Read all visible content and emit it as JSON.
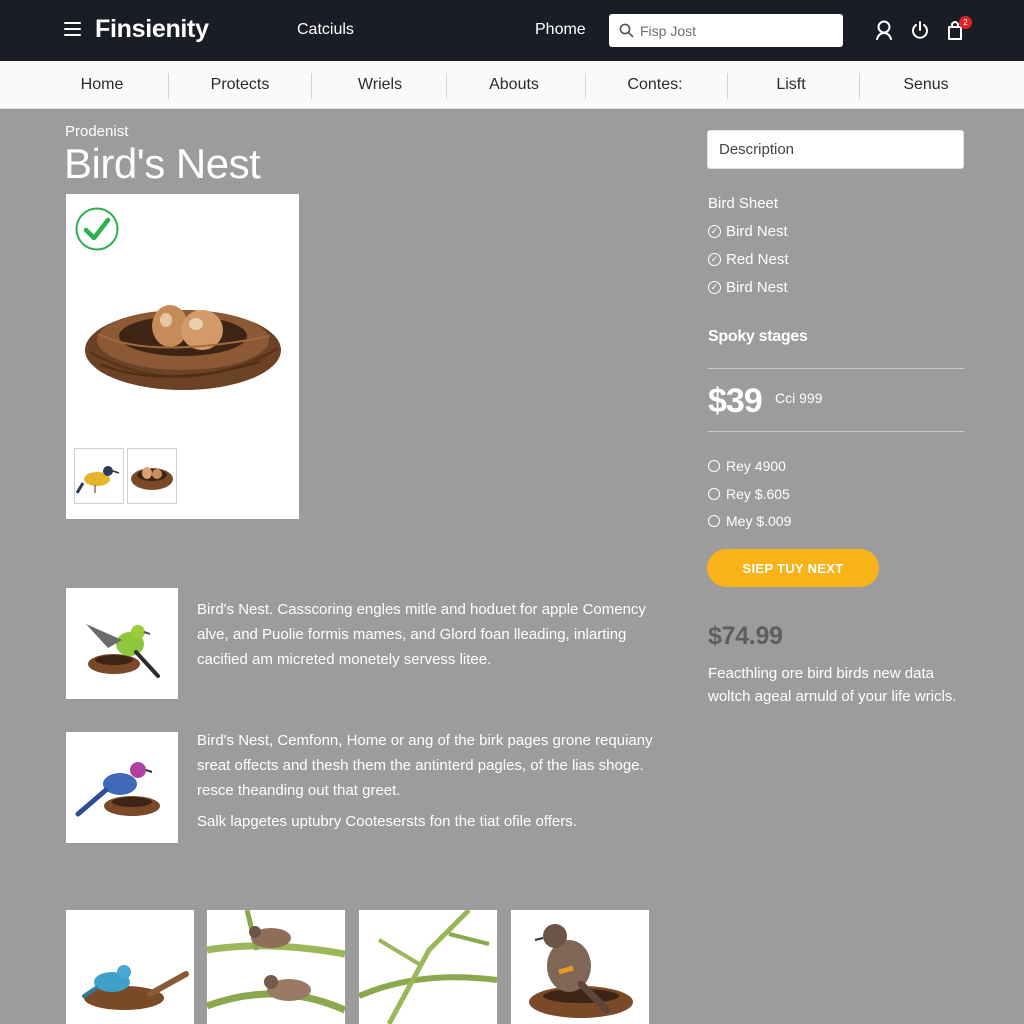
{
  "header": {
    "brand": "Finsienity",
    "link_left": "Catciuls",
    "link_right": "Phome",
    "search_placeholder": "Fisp Jost",
    "cart_badge": "2"
  },
  "nav": {
    "items": [
      "Home",
      "Protects",
      "Wriels",
      "Abouts",
      "Contes:",
      "Lisft",
      "Senus"
    ]
  },
  "product": {
    "breadcrumb": "Prodenist",
    "title": "Bird's Nest"
  },
  "descriptions": [
    "Bird's Nest. Casscoring engles mitle and hoduet for apple Comency alve, and Puolie formis mames, and Glord foan lleading, inlarting cacified am micreted monetely servess litee.",
    "Bird's Nest, Cemfonn, Home or ang of the birk pages grone requiany sreat offects and thesh them the antinterd pagles, of the lias shoge. resce theanding out that greet.",
    "Salk lapgetes uptubry Cootesersts fon the tiat ofile offers."
  ],
  "sidebar": {
    "description_placeholder": "Description",
    "sheet_label": "Bird Sheet",
    "options": [
      "Bird Nest",
      "Red Nest",
      "Bird Nest"
    ],
    "section_heading": "Spoky stages",
    "price": "$39",
    "price_note": "Cci 999",
    "variants": [
      "Rey 4900",
      "Rey $.605",
      "Mey $.009"
    ],
    "cta_label": "SIEP TUY NEXT",
    "alt_price": "$74.99",
    "note": "Feacthling ore bird birds new data woltch ageal arnuld of your life wricls."
  },
  "colors": {
    "header_bg": "#1b1d26",
    "page_bg": "#9c9c9c",
    "cta": "#f7b318",
    "check_green": "#2bb24c",
    "badge_red": "#e0222b"
  }
}
